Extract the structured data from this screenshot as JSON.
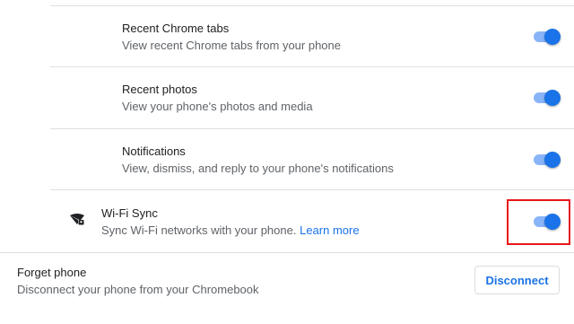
{
  "features": [
    {
      "title": "Recent Chrome tabs",
      "subtitle": "View recent Chrome tabs from your phone",
      "enabled": true
    },
    {
      "title": "Recent photos",
      "subtitle": "View your phone's photos and media",
      "enabled": true
    },
    {
      "title": "Notifications",
      "subtitle": "View, dismiss, and reply to your phone's notifications",
      "enabled": true
    }
  ],
  "wifi_sync": {
    "icon": "wifi-sync-icon",
    "title": "Wi-Fi Sync",
    "subtitle": "Sync Wi-Fi networks with your phone.",
    "link_label": "Learn more",
    "enabled": true
  },
  "forget_phone": {
    "title": "Forget phone",
    "subtitle": "Disconnect your phone from your Chromebook",
    "button_label": "Disconnect"
  },
  "colors": {
    "accent": "#1a73e8",
    "toggle_track": "#8ab4f8",
    "highlight": "#e8171b"
  }
}
